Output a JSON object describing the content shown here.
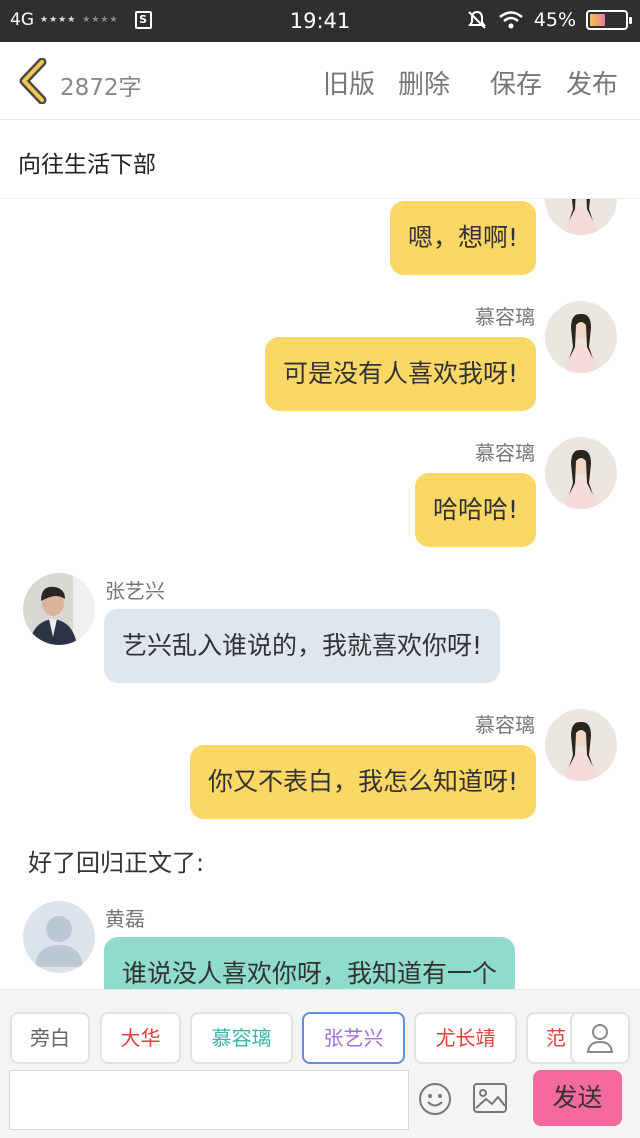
{
  "status_bar": {
    "network": "4G",
    "time": "19:41",
    "battery_text": "45%",
    "battery_level": 0.45
  },
  "header": {
    "word_count": "2872字",
    "actions": [
      "旧版",
      "删除",
      "保存",
      "发布"
    ]
  },
  "story": {
    "title": "向往生活下部"
  },
  "messages": [
    {
      "side": "right",
      "name": "",
      "text": "嗯，想啊!",
      "style": "yellow"
    },
    {
      "side": "right",
      "name": "慕容璃",
      "text": "可是没有人喜欢我呀!",
      "style": "yellow"
    },
    {
      "side": "right",
      "name": "慕容璃",
      "text": "哈哈哈!",
      "style": "yellow"
    },
    {
      "side": "left",
      "name": "张艺兴",
      "text": "艺兴乱入谁说的，我就喜欢你呀!",
      "style": "blue"
    },
    {
      "side": "right",
      "name": "慕容璃",
      "text": "你又不表白，我怎么知道呀!",
      "style": "yellow"
    },
    {
      "side": "narration",
      "text": "好了回归正文了:"
    },
    {
      "side": "left",
      "name": "黄磊",
      "text": "谁说没人喜欢你呀，我知道有一个",
      "style": "green"
    }
  ],
  "characters": [
    {
      "label": "旁白",
      "color": "#666666"
    },
    {
      "label": "大华",
      "color": "#e0403a"
    },
    {
      "label": "慕容璃",
      "color": "#3bb6a8"
    },
    {
      "label": "张艺兴",
      "color": "#a16fd6"
    },
    {
      "label": "尤长靖",
      "color": "#e0403a"
    },
    {
      "label": "范",
      "color": "#e0403a"
    }
  ],
  "input": {
    "placeholder": "",
    "value": ""
  },
  "send_label": "发送",
  "colors": {
    "bubble_yellow": "#fbd766",
    "bubble_blue": "#dfe6ef",
    "bubble_green": "#8fdbcc",
    "send_button": "#f46a9c",
    "selected_border": "#5f8de0"
  }
}
